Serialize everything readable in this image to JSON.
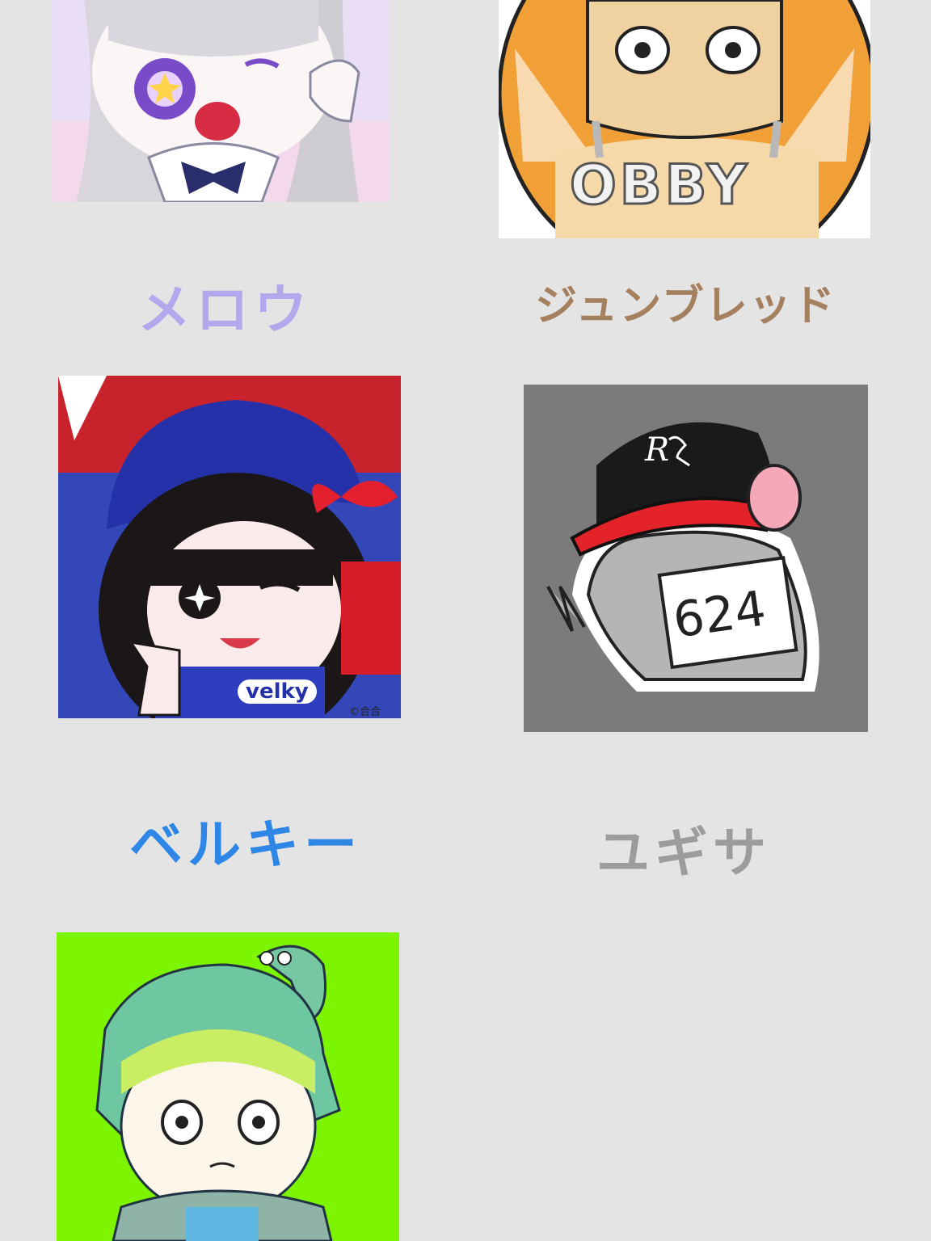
{
  "creators": [
    {
      "id": "mellow",
      "name": "メロウ",
      "color": "#b3a8ec"
    },
    {
      "id": "junbread",
      "name": "ジュンブレッド",
      "color": "#a5805e",
      "badge": "OBBY"
    },
    {
      "id": "velky",
      "name": "ベルキー",
      "color": "#2e86e6",
      "shirt": "velky",
      "credit": "©合合"
    },
    {
      "id": "yugisa",
      "name": "ユギサ",
      "color": "#9c9c9c",
      "cap": "R",
      "sign": "624"
    },
    {
      "id": "fifth",
      "name": ""
    }
  ]
}
